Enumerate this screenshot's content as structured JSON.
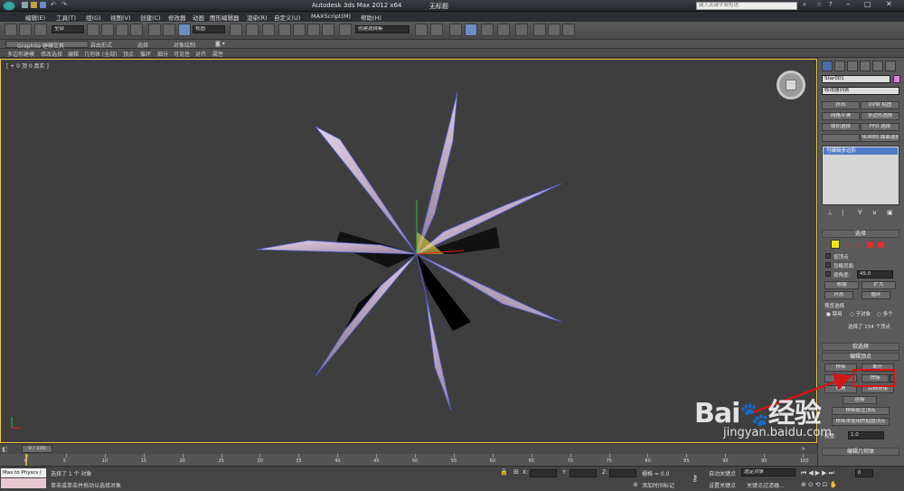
{
  "title_bar": {
    "app_title": "Autodesk 3ds Max  2012 x64",
    "file_name": "无标题",
    "search_placeholder": "键入关键字或短语"
  },
  "menus": [
    "编辑(E)",
    "工具(T)",
    "组(G)",
    "视图(V)",
    "创建(C)",
    "修改器",
    "动画",
    "图形编辑器",
    "渲染(R)",
    "自定义(U)",
    "MAXScript(M)",
    "帮助(H)"
  ],
  "toolbar": {
    "selection_filter": "全部",
    "coord_system": "视图",
    "named_selection": "创建选择集"
  },
  "ribbon": {
    "tabs": [
      "Graphite 建模工具",
      "自由形式",
      "选择",
      "对象绘制"
    ],
    "sub_items": [
      "多边形建模",
      "修改选择",
      "编辑",
      "几何体 (全部)",
      "顶点",
      "循环",
      "细分",
      "可见性",
      "对齐",
      "属性"
    ]
  },
  "viewport": {
    "label": "[ + 0 顶 0 真实 ]"
  },
  "command_panel": {
    "object_name": "Star001",
    "modifier_list": "修改器列表",
    "modifier_buttons": [
      "挤出",
      "UVW 贴图",
      "网格平滑",
      "多边形选择",
      "体积选择",
      "FFD 选择",
      "",
      "NURBS 曲面选择"
    ],
    "stack_item": "可编辑多边形",
    "selection_header": "选择",
    "by_vertex": "按顶点",
    "ignore_backfacing": "忽略背面",
    "by_angle": "按角度:",
    "angle_value": "45.0",
    "shrink": "收缩",
    "grow": "扩大",
    "ring": "环形",
    "loop": "循环",
    "preview_selection": "预览选择",
    "preview_options": [
      "禁用",
      "子对象",
      "多个"
    ],
    "selected_count": "选择了 154 个顶点",
    "soft_selection_header": "软选择",
    "edit_vertices_header": "编辑顶点",
    "remove": "移除",
    "break": "断开",
    "extrude": "挤出",
    "weld": "焊接",
    "chamfer": "切角",
    "target_weld": "目标焊接",
    "connect": "连接",
    "remove_isolated": "移除孤立顶点",
    "remove_unused_map": "移除未使用的贴图顶点",
    "weight_label": "权重:",
    "weight_value": "1.0",
    "edit_geometry_header": "编辑几何体"
  },
  "timeline": {
    "frame": "0 / 100",
    "ticks": [
      "0",
      "5",
      "10",
      "15",
      "20",
      "25",
      "30",
      "35",
      "40",
      "45",
      "50",
      "55",
      "60",
      "65",
      "70",
      "75",
      "80",
      "85",
      "90",
      "95",
      "100"
    ]
  },
  "status": {
    "maxscript_listener": "Max to Physcs (",
    "selected": "选择了 1 个 对象",
    "prompt": "单击或单击并拖动以选择对象",
    "x_label": "X:",
    "y_label": "Y:",
    "z_label": "Z:",
    "grid": "栅格 = 0.0",
    "add_time_tag": "添加时间标记",
    "auto_key": "自动关键点",
    "set_key": "设置关键点",
    "selected_object": "选定对象",
    "key_filters": "关键点过滤器...",
    "frame_value": "0"
  },
  "watermark": {
    "brand": "Bai",
    "brand2": "经验",
    "url": "jingyan.baidu.com"
  },
  "colors": {
    "star_fill": "#c4aec8",
    "viewport_border": "#e8c847",
    "arrow": "#d01818",
    "highlight_box": "#e01010",
    "selection_blue": "#6b8fc2"
  }
}
